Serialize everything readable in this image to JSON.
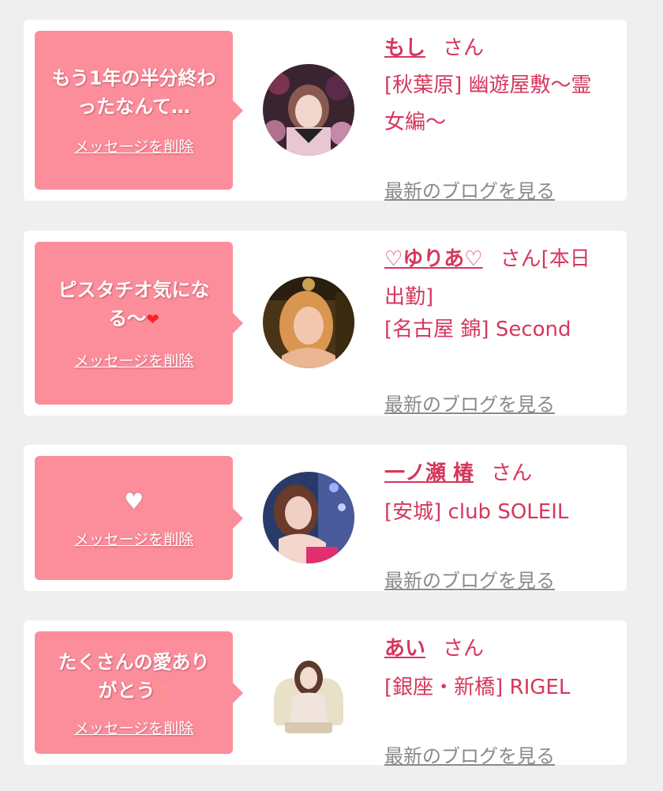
{
  "messages": [
    {
      "message_lines": [
        "もう1年の半分終わ",
        "ったなんて…"
      ],
      "delete_label": "メッセージを削除",
      "name": "もし",
      "honorific": "さん",
      "shop_lines": [
        "[秋葉原] 幽遊屋敷〜霊",
        "女編〜"
      ],
      "blog_link": "最新のブログを見る"
    },
    {
      "message_lines": [
        "ピスタチオ気にな",
        "る〜"
      ],
      "emoji": "❤",
      "delete_label": "メッセージを削除",
      "name": "♡ゆりあ♡",
      "honorific_lines": [
        "さん[本日",
        "出勤]"
      ],
      "shop_lines": [
        "[名古屋 錦] Second"
      ],
      "blog_link": "最新のブログを見る"
    },
    {
      "emoji": "♥",
      "delete_label": "メッセージを削除",
      "name": "一ノ瀬 椿",
      "honorific": "さん",
      "shop_lines": [
        "[安城] club SOLEIL"
      ],
      "blog_link": "最新のブログを見る"
    },
    {
      "message_lines": [
        "たくさんの愛あり",
        "がとう"
      ],
      "emoji": "♡",
      "delete_label": "メッセージを削除",
      "name": "あい",
      "honorific": "さん",
      "shop_lines": [
        "[銀座・新橋] RIGEL"
      ],
      "blog_link": "最新のブログを見る"
    }
  ],
  "colors": {
    "background": "#f0eff0",
    "bubble": "#fc8e9b",
    "accent": "#d6375d",
    "link_gray": "#8a8a8a"
  }
}
